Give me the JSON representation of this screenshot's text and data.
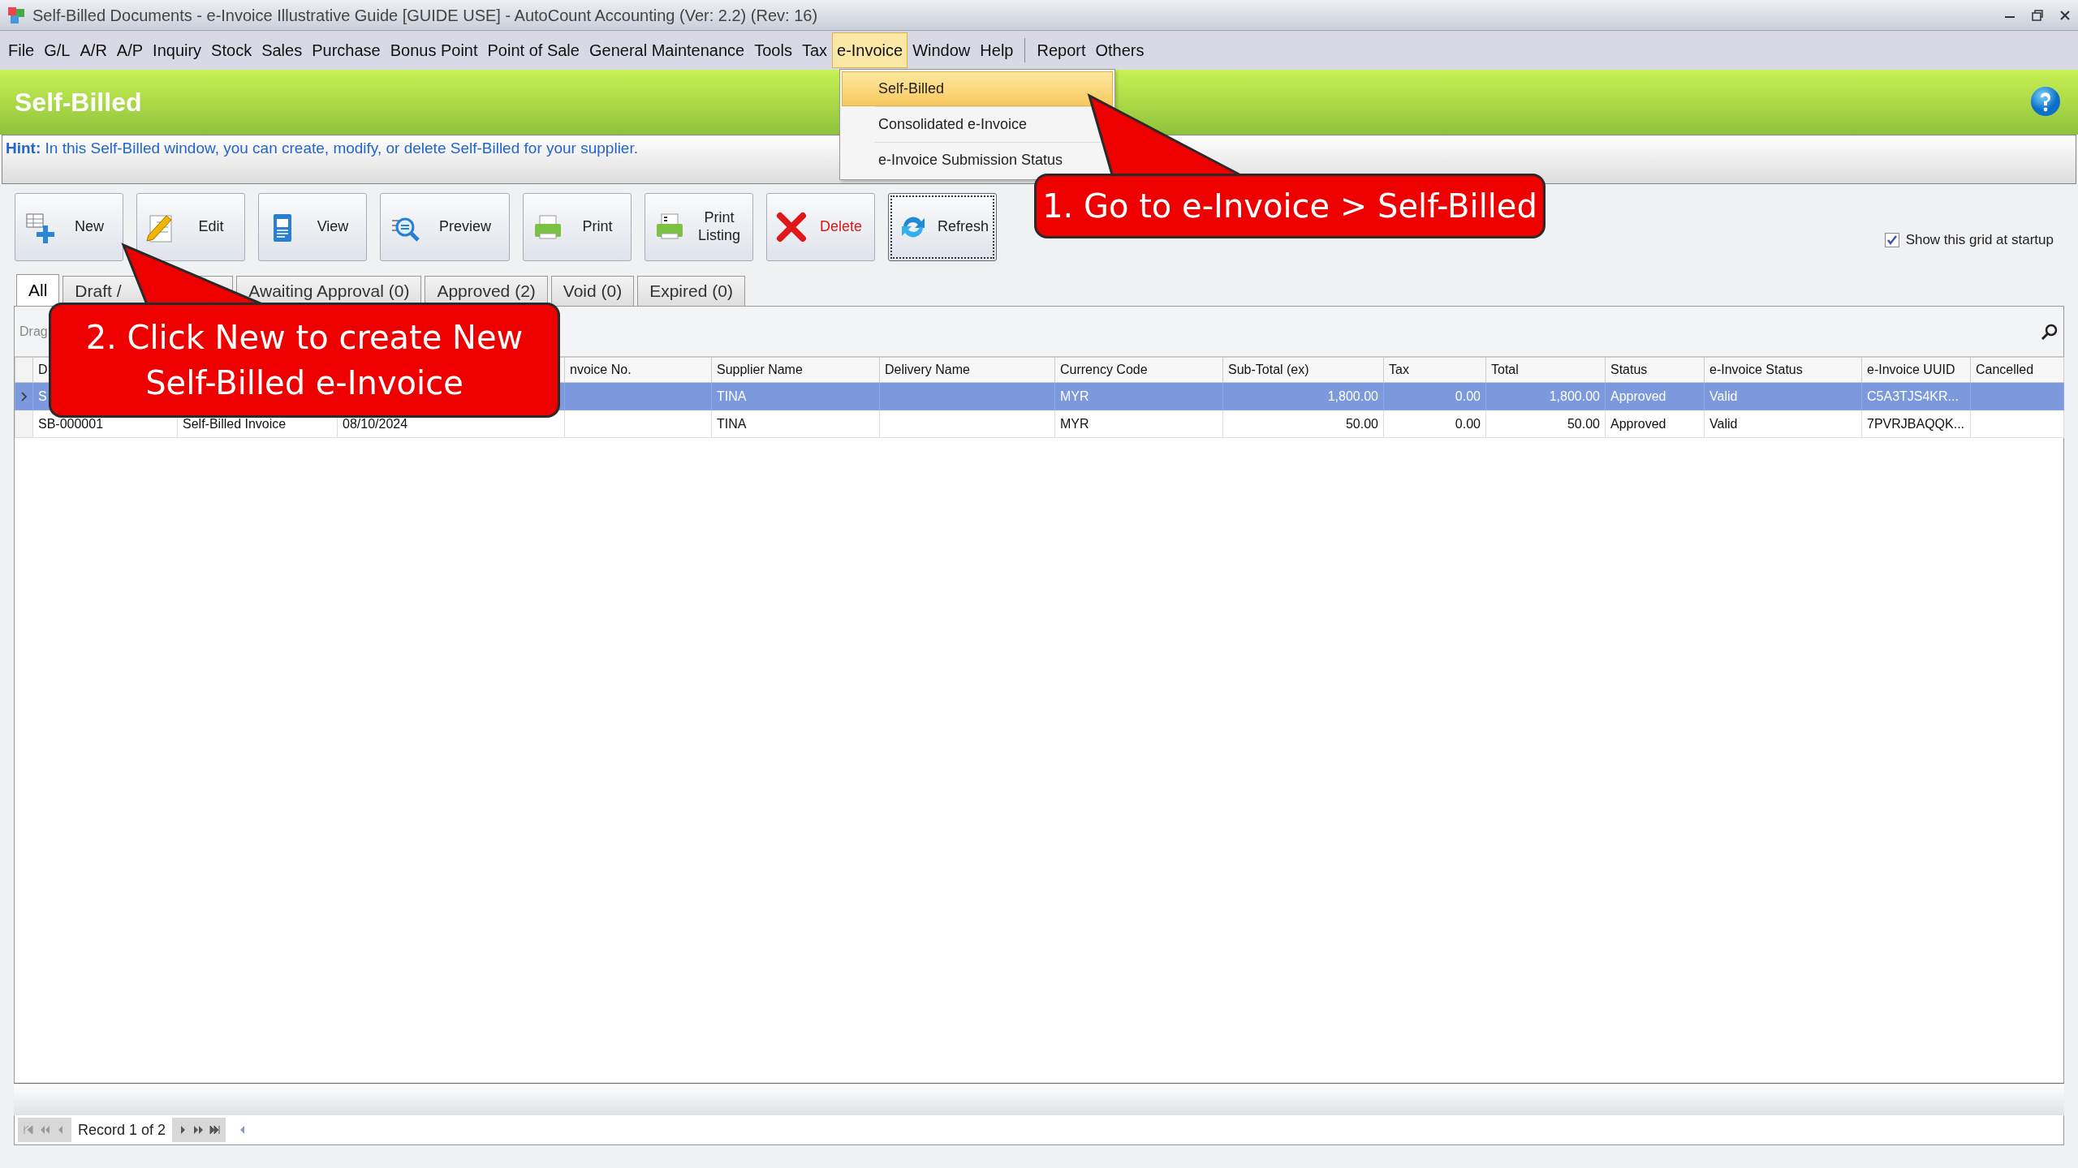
{
  "window": {
    "title": "Self-Billed Documents - e-Invoice Illustrative Guide [GUIDE USE] - AutoCount Accounting (Ver: 2.2) (Rev: 16)"
  },
  "menu": [
    {
      "kind": "item",
      "label": "File",
      "open": false
    },
    {
      "kind": "item",
      "label": "G/L",
      "open": false
    },
    {
      "kind": "item",
      "label": "A/R",
      "open": false
    },
    {
      "kind": "item",
      "label": "A/P",
      "open": false
    },
    {
      "kind": "item",
      "label": "Inquiry",
      "open": false
    },
    {
      "kind": "item",
      "label": "Stock",
      "open": false
    },
    {
      "kind": "item",
      "label": "Sales",
      "open": false
    },
    {
      "kind": "item",
      "label": "Purchase",
      "open": false
    },
    {
      "kind": "item",
      "label": "Bonus Point",
      "open": false
    },
    {
      "kind": "item",
      "label": "Point of Sale",
      "open": false
    },
    {
      "kind": "item",
      "label": "General Maintenance",
      "open": false
    },
    {
      "kind": "item",
      "label": "Tools",
      "open": false
    },
    {
      "kind": "item",
      "label": "Tax",
      "open": false
    },
    {
      "kind": "item",
      "label": "e-Invoice",
      "open": true
    },
    {
      "kind": "item",
      "label": "Window",
      "open": false
    },
    {
      "kind": "item",
      "label": "Help",
      "open": false
    },
    {
      "kind": "separator"
    },
    {
      "kind": "item",
      "label": "Report",
      "open": false
    },
    {
      "kind": "item",
      "label": "Others",
      "open": false
    }
  ],
  "dropdown": {
    "items": [
      {
        "label": "Self-Billed",
        "selected": true
      },
      {
        "label": "Consolidated e-Invoice",
        "selected": false
      },
      {
        "label": "e-Invoice Submission Status",
        "selected": false
      }
    ]
  },
  "header": {
    "title": "Self-Billed"
  },
  "hint": {
    "label": "Hint:",
    "text": "In this Self-Billed window, you can create, modify, or delete Self-Billed for your supplier."
  },
  "toolbar": [
    {
      "kind": "new",
      "label": "New",
      "focused": false
    },
    {
      "kind": "edit",
      "label": "Edit",
      "focused": false
    },
    {
      "kind": "view",
      "label": "View",
      "focused": false
    },
    {
      "kind": "preview",
      "label": "Preview",
      "focused": false
    },
    {
      "kind": "print",
      "label": "Print",
      "focused": false
    },
    {
      "kind": "print-listing",
      "label": "Print Listing",
      "focused": false
    },
    {
      "kind": "delete",
      "label": "Delete",
      "focused": false
    },
    {
      "kind": "refresh",
      "label": "Refresh",
      "focused": true
    }
  ],
  "startup_option": {
    "label": "Show this grid at startup",
    "checked": true
  },
  "tabs": [
    {
      "label": "All",
      "selected": true
    },
    {
      "label": "Draft /",
      "selected": false
    },
    {
      "label": "Awaiting Approval (0)",
      "selected": false
    },
    {
      "label": "Approved (2)",
      "selected": false
    },
    {
      "label": "Void (0)",
      "selected": false
    },
    {
      "label": "Expired (0)",
      "selected": false
    }
  ],
  "group_panel": {
    "text": "Drag"
  },
  "grid": {
    "columns": [
      {
        "header": "D"
      },
      {},
      {},
      {
        "header": "nvoice No."
      },
      {
        "header": "Supplier Name"
      },
      {
        "header": "Delivery Name"
      },
      {
        "header": "Currency Code"
      },
      {
        "header": "Sub-Total (ex)",
        "numeric": true
      },
      {
        "header": "Tax",
        "numeric": true
      },
      {
        "header": "Total",
        "numeric": true
      },
      {
        "header": "Status"
      },
      {
        "header": "e-Invoice Status"
      },
      {
        "header": "e-Invoice UUID"
      },
      {
        "header": "Cancelled"
      }
    ],
    "rows": [
      {
        "selected": true,
        "cells": [
          "S",
          null,
          null,
          null,
          "TINA",
          null,
          "MYR",
          "1,800.00",
          "0.00",
          "1,800.00",
          "Approved",
          "Valid",
          "C5A3TJS4KR...",
          null
        ]
      },
      {
        "selected": false,
        "cells": [
          "SB-000001",
          "Self-Billed Invoice",
          "08/10/2024",
          null,
          "TINA",
          null,
          "MYR",
          "50.00",
          "0.00",
          "50.00",
          "Approved",
          "Valid",
          "7PVRJBAQQK...",
          null
        ]
      }
    ]
  },
  "navigator": {
    "text": "Record 1 of 2"
  },
  "callouts": [
    {
      "text": "1. Go to e-Invoice > Self-Billed"
    },
    {
      "text": "2. Click New to create New Self-Billed e-Invoice"
    }
  ]
}
